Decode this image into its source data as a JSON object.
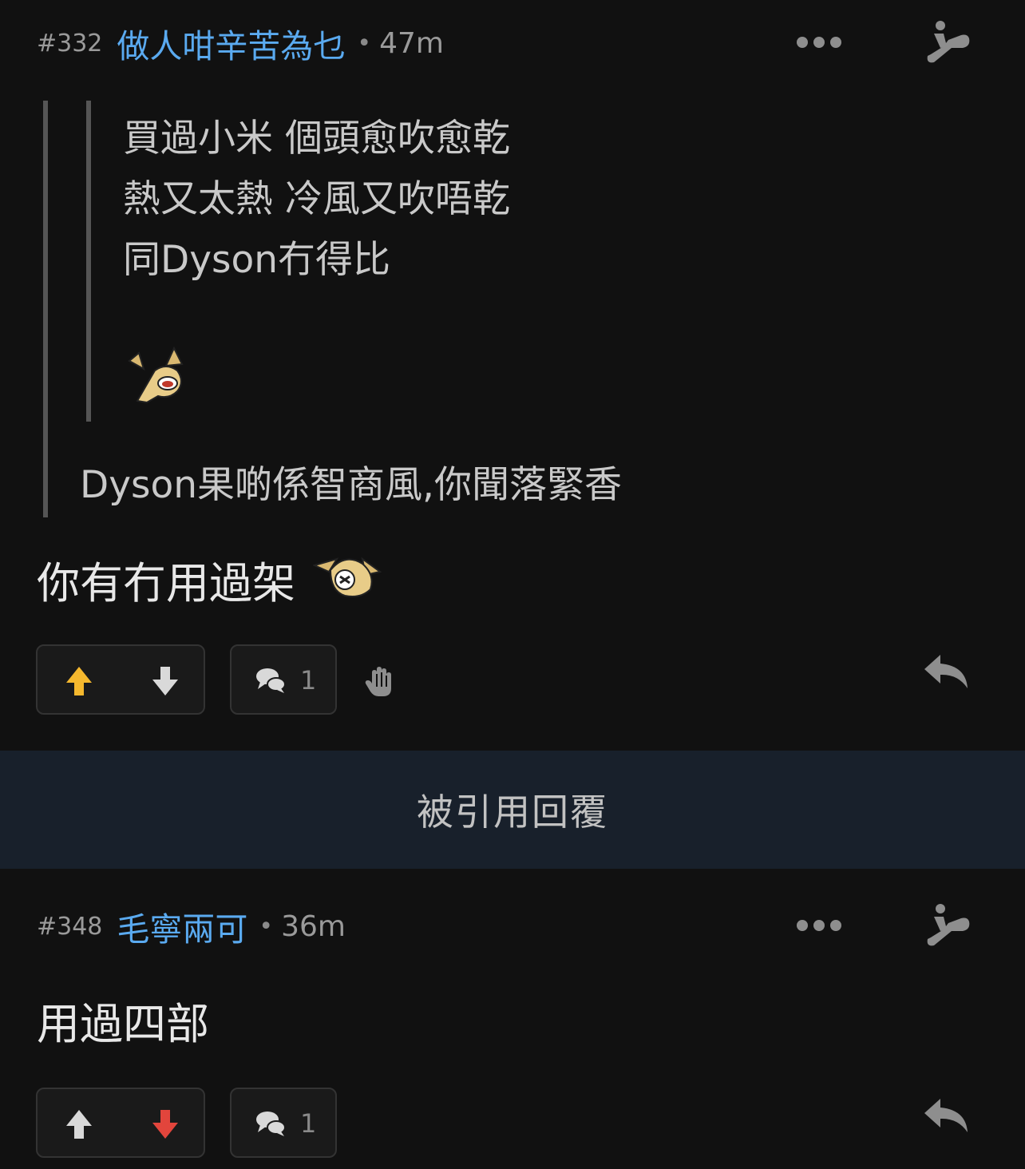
{
  "posts": [
    {
      "number": "#332",
      "username": "做人咁辛苦為乜",
      "separator": "•",
      "time": "47m",
      "quote": {
        "nested_lines": [
          "買過小米 個頭愈吹愈乾",
          "熱又太熱 冷風又吹唔乾",
          "同Dyson冇得比"
        ],
        "text": "Dyson果啲係智商風,你聞落緊香"
      },
      "body": "你有冇用過架",
      "comment_count": "1",
      "vote_state": "up",
      "colors": {
        "up_active": "#f5b82e",
        "neutral": "#d9d9d9"
      }
    },
    {
      "number": "#348",
      "username": "毛寧兩可",
      "separator": "•",
      "time": "36m",
      "body": "用過四部",
      "comment_count": "1",
      "vote_state": "down",
      "colors": {
        "down_active": "#e2453c",
        "neutral": "#d9d9d9"
      }
    }
  ],
  "divider": {
    "label": "被引用回覆"
  },
  "icons": {
    "more": "more-dots-icon",
    "escalator": "escalator-icon",
    "upvote": "arrow-up-icon",
    "downvote": "arrow-down-icon",
    "comment": "comment-bubbles-icon",
    "hand": "hand-icon",
    "reply": "reply-arrow-icon",
    "sticker": "sticker-icon"
  },
  "theme": {
    "username_color": "#5aaaf0",
    "background": "#111111",
    "divider_bg": "#18202b"
  }
}
